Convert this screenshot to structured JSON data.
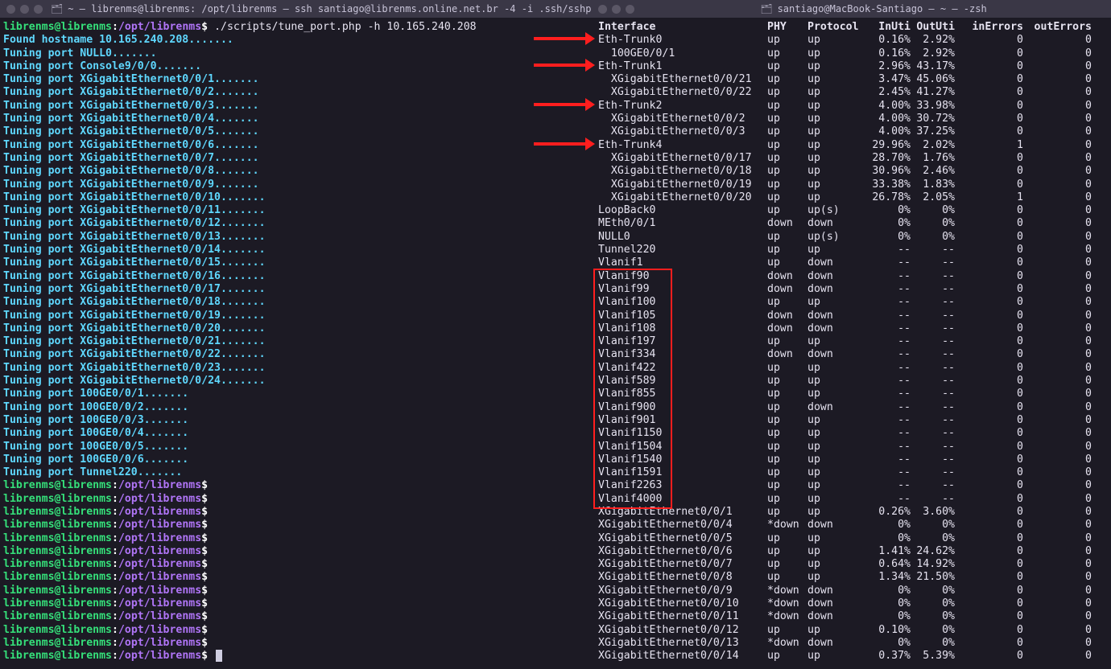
{
  "left": {
    "title": "~ — librenms@librenms: /opt/librenms — ssh santiago@librenms.online.net.br -4 -i .ssh/sshpass_onlinetel...",
    "prompt_user": "librenms@librenms",
    "prompt_path": "/opt/librenms",
    "command": "./scripts/tune_port.php -h 10.165.240.208",
    "found": "Found hostname 10.165.240.208.......",
    "tuning": [
      "Tuning port NULL0.......",
      "Tuning port Console9/0/0.......",
      "Tuning port XGigabitEthernet0/0/1.......",
      "Tuning port XGigabitEthernet0/0/2.......",
      "Tuning port XGigabitEthernet0/0/3.......",
      "Tuning port XGigabitEthernet0/0/4.......",
      "Tuning port XGigabitEthernet0/0/5.......",
      "Tuning port XGigabitEthernet0/0/6.......",
      "Tuning port XGigabitEthernet0/0/7.......",
      "Tuning port XGigabitEthernet0/0/8.......",
      "Tuning port XGigabitEthernet0/0/9.......",
      "Tuning port XGigabitEthernet0/0/10.......",
      "Tuning port XGigabitEthernet0/0/11.......",
      "Tuning port XGigabitEthernet0/0/12.......",
      "Tuning port XGigabitEthernet0/0/13.......",
      "Tuning port XGigabitEthernet0/0/14.......",
      "Tuning port XGigabitEthernet0/0/15.......",
      "Tuning port XGigabitEthernet0/0/16.......",
      "Tuning port XGigabitEthernet0/0/17.......",
      "Tuning port XGigabitEthernet0/0/18.......",
      "Tuning port XGigabitEthernet0/0/19.......",
      "Tuning port XGigabitEthernet0/0/20.......",
      "Tuning port XGigabitEthernet0/0/21.......",
      "Tuning port XGigabitEthernet0/0/22.......",
      "Tuning port XGigabitEthernet0/0/23.......",
      "Tuning port XGigabitEthernet0/0/24.......",
      "Tuning port 100GE0/0/1.......",
      "Tuning port 100GE0/0/2.......",
      "Tuning port 100GE0/0/3.......",
      "Tuning port 100GE0/0/4.......",
      "Tuning port 100GE0/0/5.......",
      "Tuning port 100GE0/0/6.......",
      "Tuning port Tunnel220......."
    ],
    "idle_prompts": 13
  },
  "right": {
    "title": "santiago@MacBook-Santiago — ~ — -zsh",
    "headers": {
      "iface": "Interface",
      "phy": "PHY",
      "proto": "Protocol",
      "in": "InUti",
      "out": "OutUti",
      "ier": "inErrors",
      "oer": "outErrors"
    },
    "rows": [
      {
        "iface": "Eth-Trunk0",
        "phy": "up",
        "proto": "up",
        "in": "0.16%",
        "out": "2.92%",
        "ier": "0",
        "oer": "0",
        "arrow": true
      },
      {
        "iface": "  100GE0/0/1",
        "phy": "up",
        "proto": "up",
        "in": "0.16%",
        "out": "2.92%",
        "ier": "0",
        "oer": "0"
      },
      {
        "iface": "Eth-Trunk1",
        "phy": "up",
        "proto": "up",
        "in": "2.96%",
        "out": "43.17%",
        "ier": "0",
        "oer": "0",
        "arrow": true
      },
      {
        "iface": "  XGigabitEthernet0/0/21",
        "phy": "up",
        "proto": "up",
        "in": "3.47%",
        "out": "45.06%",
        "ier": "0",
        "oer": "0"
      },
      {
        "iface": "  XGigabitEthernet0/0/22",
        "phy": "up",
        "proto": "up",
        "in": "2.45%",
        "out": "41.27%",
        "ier": "0",
        "oer": "0"
      },
      {
        "iface": "Eth-Trunk2",
        "phy": "up",
        "proto": "up",
        "in": "4.00%",
        "out": "33.98%",
        "ier": "0",
        "oer": "0",
        "arrow": true
      },
      {
        "iface": "  XGigabitEthernet0/0/2",
        "phy": "up",
        "proto": "up",
        "in": "4.00%",
        "out": "30.72%",
        "ier": "0",
        "oer": "0"
      },
      {
        "iface": "  XGigabitEthernet0/0/3",
        "phy": "up",
        "proto": "up",
        "in": "4.00%",
        "out": "37.25%",
        "ier": "0",
        "oer": "0"
      },
      {
        "iface": "Eth-Trunk4",
        "phy": "up",
        "proto": "up",
        "in": "29.96%",
        "out": "2.02%",
        "ier": "1",
        "oer": "0",
        "arrow": true
      },
      {
        "iface": "  XGigabitEthernet0/0/17",
        "phy": "up",
        "proto": "up",
        "in": "28.70%",
        "out": "1.76%",
        "ier": "0",
        "oer": "0"
      },
      {
        "iface": "  XGigabitEthernet0/0/18",
        "phy": "up",
        "proto": "up",
        "in": "30.96%",
        "out": "2.46%",
        "ier": "0",
        "oer": "0"
      },
      {
        "iface": "  XGigabitEthernet0/0/19",
        "phy": "up",
        "proto": "up",
        "in": "33.38%",
        "out": "1.83%",
        "ier": "0",
        "oer": "0"
      },
      {
        "iface": "  XGigabitEthernet0/0/20",
        "phy": "up",
        "proto": "up",
        "in": "26.78%",
        "out": "2.05%",
        "ier": "1",
        "oer": "0"
      },
      {
        "iface": "LoopBack0",
        "phy": "up",
        "proto": "up(s)",
        "in": "0%",
        "out": "0%",
        "ier": "0",
        "oer": "0"
      },
      {
        "iface": "MEth0/0/1",
        "phy": "down",
        "proto": "down",
        "in": "0%",
        "out": "0%",
        "ier": "0",
        "oer": "0"
      },
      {
        "iface": "NULL0",
        "phy": "up",
        "proto": "up(s)",
        "in": "0%",
        "out": "0%",
        "ier": "0",
        "oer": "0"
      },
      {
        "iface": "Tunnel220",
        "phy": "up",
        "proto": "up",
        "in": "--",
        "out": "--",
        "ier": "0",
        "oer": "0"
      },
      {
        "iface": "Vlanif1",
        "phy": "up",
        "proto": "down",
        "in": "--",
        "out": "--",
        "ier": "0",
        "oer": "0"
      },
      {
        "iface": "Vlanif90",
        "phy": "down",
        "proto": "down",
        "in": "--",
        "out": "--",
        "ier": "0",
        "oer": "0",
        "box": "start"
      },
      {
        "iface": "Vlanif99",
        "phy": "down",
        "proto": "down",
        "in": "--",
        "out": "--",
        "ier": "0",
        "oer": "0"
      },
      {
        "iface": "Vlanif100",
        "phy": "up",
        "proto": "up",
        "in": "--",
        "out": "--",
        "ier": "0",
        "oer": "0"
      },
      {
        "iface": "Vlanif105",
        "phy": "down",
        "proto": "down",
        "in": "--",
        "out": "--",
        "ier": "0",
        "oer": "0"
      },
      {
        "iface": "Vlanif108",
        "phy": "down",
        "proto": "down",
        "in": "--",
        "out": "--",
        "ier": "0",
        "oer": "0"
      },
      {
        "iface": "Vlanif197",
        "phy": "up",
        "proto": "up",
        "in": "--",
        "out": "--",
        "ier": "0",
        "oer": "0"
      },
      {
        "iface": "Vlanif334",
        "phy": "down",
        "proto": "down",
        "in": "--",
        "out": "--",
        "ier": "0",
        "oer": "0"
      },
      {
        "iface": "Vlanif422",
        "phy": "up",
        "proto": "up",
        "in": "--",
        "out": "--",
        "ier": "0",
        "oer": "0"
      },
      {
        "iface": "Vlanif589",
        "phy": "up",
        "proto": "up",
        "in": "--",
        "out": "--",
        "ier": "0",
        "oer": "0"
      },
      {
        "iface": "Vlanif855",
        "phy": "up",
        "proto": "up",
        "in": "--",
        "out": "--",
        "ier": "0",
        "oer": "0"
      },
      {
        "iface": "Vlanif900",
        "phy": "up",
        "proto": "down",
        "in": "--",
        "out": "--",
        "ier": "0",
        "oer": "0"
      },
      {
        "iface": "Vlanif901",
        "phy": "up",
        "proto": "up",
        "in": "--",
        "out": "--",
        "ier": "0",
        "oer": "0"
      },
      {
        "iface": "Vlanif1150",
        "phy": "up",
        "proto": "up",
        "in": "--",
        "out": "--",
        "ier": "0",
        "oer": "0"
      },
      {
        "iface": "Vlanif1504",
        "phy": "up",
        "proto": "up",
        "in": "--",
        "out": "--",
        "ier": "0",
        "oer": "0"
      },
      {
        "iface": "Vlanif1540",
        "phy": "up",
        "proto": "up",
        "in": "--",
        "out": "--",
        "ier": "0",
        "oer": "0"
      },
      {
        "iface": "Vlanif1591",
        "phy": "up",
        "proto": "up",
        "in": "--",
        "out": "--",
        "ier": "0",
        "oer": "0"
      },
      {
        "iface": "Vlanif2263",
        "phy": "up",
        "proto": "up",
        "in": "--",
        "out": "--",
        "ier": "0",
        "oer": "0"
      },
      {
        "iface": "Vlanif4000",
        "phy": "up",
        "proto": "up",
        "in": "--",
        "out": "--",
        "ier": "0",
        "oer": "0",
        "box": "end"
      },
      {
        "iface": "XGigabitEthernet0/0/1",
        "phy": "up",
        "proto": "up",
        "in": "0.26%",
        "out": "3.60%",
        "ier": "0",
        "oer": "0"
      },
      {
        "iface": "XGigabitEthernet0/0/4",
        "phy": "*down",
        "proto": "down",
        "in": "0%",
        "out": "0%",
        "ier": "0",
        "oer": "0"
      },
      {
        "iface": "XGigabitEthernet0/0/5",
        "phy": "up",
        "proto": "up",
        "in": "0%",
        "out": "0%",
        "ier": "0",
        "oer": "0"
      },
      {
        "iface": "XGigabitEthernet0/0/6",
        "phy": "up",
        "proto": "up",
        "in": "1.41%",
        "out": "24.62%",
        "ier": "0",
        "oer": "0"
      },
      {
        "iface": "XGigabitEthernet0/0/7",
        "phy": "up",
        "proto": "up",
        "in": "0.64%",
        "out": "14.92%",
        "ier": "0",
        "oer": "0"
      },
      {
        "iface": "XGigabitEthernet0/0/8",
        "phy": "up",
        "proto": "up",
        "in": "1.34%",
        "out": "21.50%",
        "ier": "0",
        "oer": "0"
      },
      {
        "iface": "XGigabitEthernet0/0/9",
        "phy": "*down",
        "proto": "down",
        "in": "0%",
        "out": "0%",
        "ier": "0",
        "oer": "0"
      },
      {
        "iface": "XGigabitEthernet0/0/10",
        "phy": "*down",
        "proto": "down",
        "in": "0%",
        "out": "0%",
        "ier": "0",
        "oer": "0"
      },
      {
        "iface": "XGigabitEthernet0/0/11",
        "phy": "*down",
        "proto": "down",
        "in": "0%",
        "out": "0%",
        "ier": "0",
        "oer": "0"
      },
      {
        "iface": "XGigabitEthernet0/0/12",
        "phy": "up",
        "proto": "up",
        "in": "0.10%",
        "out": "0%",
        "ier": "0",
        "oer": "0"
      },
      {
        "iface": "XGigabitEthernet0/0/13",
        "phy": "*down",
        "proto": "down",
        "in": "0%",
        "out": "0%",
        "ier": "0",
        "oer": "0"
      },
      {
        "iface": "XGigabitEthernet0/0/14",
        "phy": "up",
        "proto": "up",
        "in": "0.37%",
        "out": "5.39%",
        "ier": "0",
        "oer": "0"
      }
    ]
  }
}
